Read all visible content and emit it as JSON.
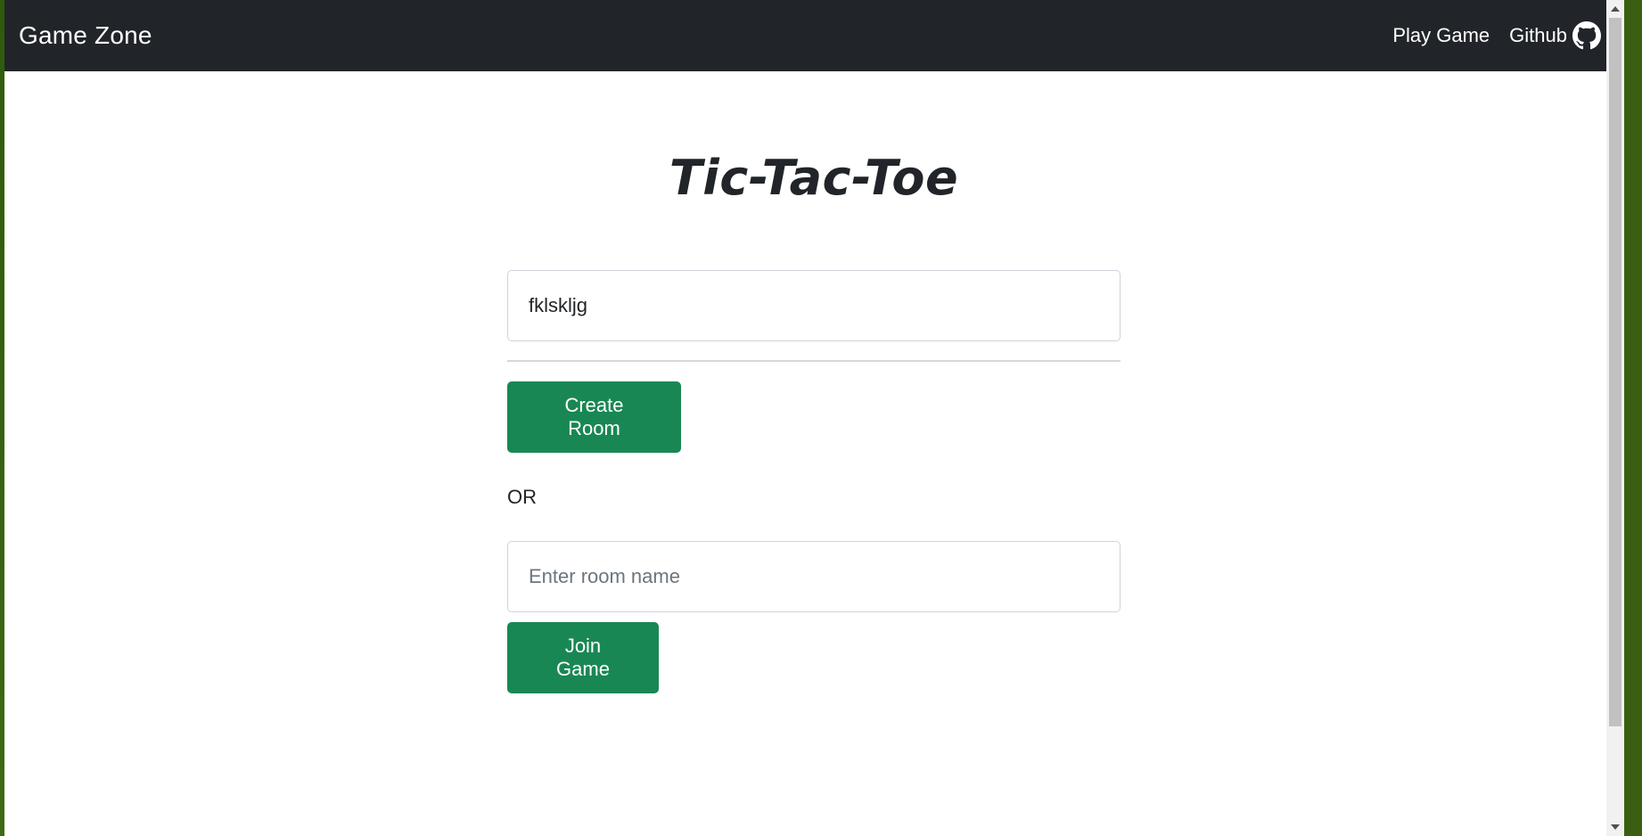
{
  "navbar": {
    "brand": "Game Zone",
    "links": {
      "play_game": "Play Game",
      "github": "Github"
    },
    "github_icon": "github-icon",
    "background": "#212529"
  },
  "main": {
    "title": "Tic-Tac-Toe",
    "username_input": {
      "value": "fklskljg"
    },
    "create_room_label": "Create Room",
    "or_label": "OR",
    "room_input": {
      "value": "",
      "placeholder": "Enter room name"
    },
    "join_game_label": "Join Game"
  },
  "colors": {
    "accent": "#198754",
    "text": "#212529"
  }
}
